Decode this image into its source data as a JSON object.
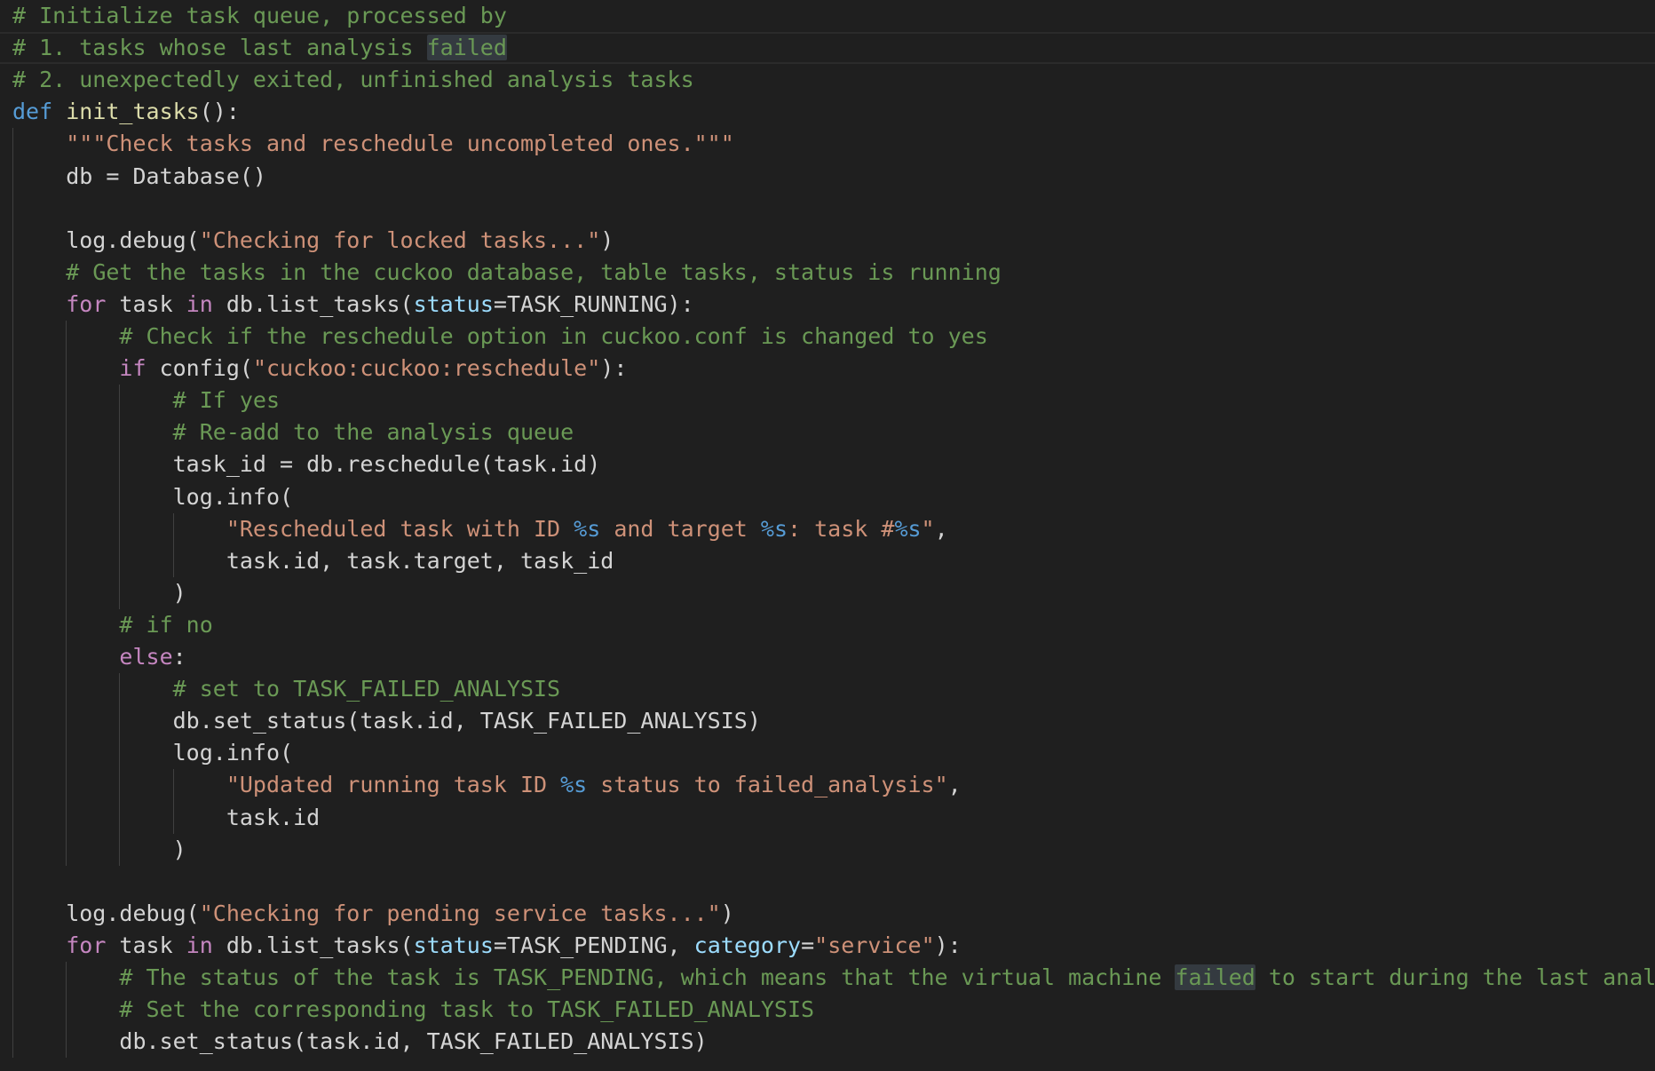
{
  "editor": {
    "language": "python",
    "theme_colors": {
      "background": "#1f1f1f",
      "comment": "#6a9955",
      "keyword": "#569cd6",
      "control_keyword": "#c586c0",
      "function": "#dcdcaa",
      "string": "#ce9178",
      "parameter": "#9cdcfe",
      "default_text": "#d4d4d4"
    },
    "highlighted_word": "failed",
    "lines": [
      [
        {
          "t": "c",
          "v": "# Initialize task queue, processed by"
        }
      ],
      [
        {
          "t": "c",
          "v": "# 1. tasks whose last analysis "
        },
        {
          "t": "c hl",
          "v": "failed"
        }
      ],
      [
        {
          "t": "c",
          "v": "# 2. unexpectedly exited, unfinished analysis tasks"
        }
      ],
      [
        {
          "t": "k",
          "v": "def"
        },
        {
          "t": "",
          "v": " "
        },
        {
          "t": "f",
          "v": "init_tasks"
        },
        {
          "t": "",
          "v": "():"
        }
      ],
      [
        {
          "t": "",
          "v": "    "
        },
        {
          "t": "s",
          "v": "\"\"\"Check tasks and reschedule uncompleted ones.\"\"\""
        }
      ],
      [
        {
          "t": "",
          "v": "    db = Database()"
        }
      ],
      [],
      [
        {
          "t": "",
          "v": "    log.debug("
        },
        {
          "t": "s",
          "v": "\"Checking for locked tasks...\""
        },
        {
          "t": "",
          "v": ")"
        }
      ],
      [
        {
          "t": "",
          "v": "    "
        },
        {
          "t": "c",
          "v": "# Get the tasks in the cuckoo database, table tasks, status is running"
        }
      ],
      [
        {
          "t": "",
          "v": "    "
        },
        {
          "t": "kc",
          "v": "for"
        },
        {
          "t": "",
          "v": " task "
        },
        {
          "t": "kc",
          "v": "in"
        },
        {
          "t": "",
          "v": " db.list_tasks("
        },
        {
          "t": "pv",
          "v": "status"
        },
        {
          "t": "",
          "v": "=TASK_RUNNING):"
        }
      ],
      [
        {
          "t": "",
          "v": "        "
        },
        {
          "t": "c",
          "v": "# Check if the reschedule option in cuckoo.conf is changed to yes"
        }
      ],
      [
        {
          "t": "",
          "v": "        "
        },
        {
          "t": "kc",
          "v": "if"
        },
        {
          "t": "",
          "v": " config("
        },
        {
          "t": "s",
          "v": "\"cuckoo:cuckoo:reschedule\""
        },
        {
          "t": "",
          "v": "):"
        }
      ],
      [
        {
          "t": "",
          "v": "            "
        },
        {
          "t": "c",
          "v": "# If yes"
        }
      ],
      [
        {
          "t": "",
          "v": "            "
        },
        {
          "t": "c",
          "v": "# Re-add to the analysis queue"
        }
      ],
      [
        {
          "t": "",
          "v": "            task_id = db.reschedule(task.id)"
        }
      ],
      [
        {
          "t": "",
          "v": "            log.info("
        }
      ],
      [
        {
          "t": "",
          "v": "                "
        },
        {
          "t": "s",
          "v": "\"Rescheduled task with ID "
        },
        {
          "t": "fmt",
          "v": "%s"
        },
        {
          "t": "s",
          "v": " and target "
        },
        {
          "t": "fmt",
          "v": "%s"
        },
        {
          "t": "s",
          "v": ": task #"
        },
        {
          "t": "fmt",
          "v": "%s"
        },
        {
          "t": "s",
          "v": "\""
        },
        {
          "t": "",
          "v": ","
        }
      ],
      [
        {
          "t": "",
          "v": "                task.id, task.target, task_id"
        }
      ],
      [
        {
          "t": "",
          "v": "            )"
        }
      ],
      [
        {
          "t": "",
          "v": "        "
        },
        {
          "t": "c",
          "v": "# if no"
        }
      ],
      [
        {
          "t": "",
          "v": "        "
        },
        {
          "t": "kc",
          "v": "else"
        },
        {
          "t": "",
          "v": ":"
        }
      ],
      [
        {
          "t": "",
          "v": "            "
        },
        {
          "t": "c",
          "v": "# set to TASK_FAILED_ANALYSIS"
        }
      ],
      [
        {
          "t": "",
          "v": "            db.set_status(task.id, TASK_FAILED_ANALYSIS)"
        }
      ],
      [
        {
          "t": "",
          "v": "            log.info("
        }
      ],
      [
        {
          "t": "",
          "v": "                "
        },
        {
          "t": "s",
          "v": "\"Updated running task ID "
        },
        {
          "t": "fmt",
          "v": "%s"
        },
        {
          "t": "s",
          "v": " status to failed_analysis\""
        },
        {
          "t": "",
          "v": ","
        }
      ],
      [
        {
          "t": "",
          "v": "                task.id"
        }
      ],
      [
        {
          "t": "",
          "v": "            )"
        }
      ],
      [],
      [
        {
          "t": "",
          "v": "    log.debug("
        },
        {
          "t": "s",
          "v": "\"Checking for pending service tasks...\""
        },
        {
          "t": "",
          "v": ")"
        }
      ],
      [
        {
          "t": "",
          "v": "    "
        },
        {
          "t": "kc",
          "v": "for"
        },
        {
          "t": "",
          "v": " task "
        },
        {
          "t": "kc",
          "v": "in"
        },
        {
          "t": "",
          "v": " db.list_tasks("
        },
        {
          "t": "pv",
          "v": "status"
        },
        {
          "t": "",
          "v": "=TASK_PENDING, "
        },
        {
          "t": "pv",
          "v": "category"
        },
        {
          "t": "",
          "v": "="
        },
        {
          "t": "s",
          "v": "\"service\""
        },
        {
          "t": "",
          "v": "):"
        }
      ],
      [
        {
          "t": "",
          "v": "        "
        },
        {
          "t": "c",
          "v": "# The status of the task is TASK_PENDING, which means that the virtual machine "
        },
        {
          "t": "c hl",
          "v": "failed"
        },
        {
          "t": "c",
          "v": " to start during the last analysis"
        }
      ],
      [
        {
          "t": "",
          "v": "        "
        },
        {
          "t": "c",
          "v": "# Set the corresponding task to TASK_FAILED_ANALYSIS"
        }
      ],
      [
        {
          "t": "",
          "v": "        db.set_status(task.id, TASK_FAILED_ANALYSIS)"
        }
      ]
    ]
  }
}
